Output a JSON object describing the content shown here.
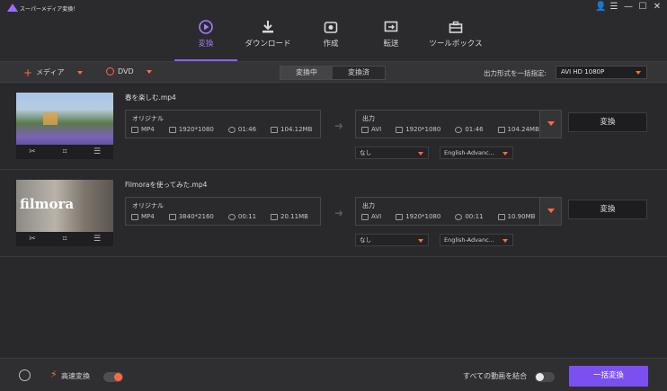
{
  "app": {
    "title": "スーパーメディア変換！"
  },
  "window_controls": [
    {
      "name": "user-icon",
      "glyph": "👤"
    },
    {
      "name": "menu-icon",
      "glyph": "☰"
    },
    {
      "name": "minimize-icon",
      "glyph": "—"
    },
    {
      "name": "maximize-icon",
      "glyph": "☐"
    },
    {
      "name": "close-icon",
      "glyph": "✕"
    }
  ],
  "nav": {
    "items": [
      {
        "label": "変換",
        "icon": "play-circle-icon",
        "active": true
      },
      {
        "label": "ダウンロード",
        "icon": "download-icon",
        "active": false
      },
      {
        "label": "作成",
        "icon": "disc-icon",
        "active": false
      },
      {
        "label": "転送",
        "icon": "transfer-icon",
        "active": false
      },
      {
        "label": "ツールボックス",
        "icon": "toolbox-icon",
        "active": false
      }
    ]
  },
  "toolbar": {
    "add_media": "メディア",
    "dvd": "DVD",
    "tabs": [
      "変換中",
      "変換済"
    ],
    "active_tab": "変換中",
    "format_label": "出力形式を一括指定:",
    "format_value": "AVI HD 1080P"
  },
  "files": [
    {
      "name": "春を楽しむ.mp4",
      "source": {
        "title": "オリジナル",
        "format": "MP4",
        "resolution": "1920*1080",
        "duration": "01:46",
        "size": "104.12MB"
      },
      "output": {
        "title": "出力",
        "format": "AVI",
        "resolution": "1920*1080",
        "duration": "01:46",
        "size": "104.24MB"
      },
      "subtitle": "なし",
      "audio": "English-Advanc...",
      "convert_label": "変換"
    },
    {
      "name": "Filmoraを使ってみた.mp4",
      "thumb_text": "filmora",
      "source": {
        "title": "オリジナル",
        "format": "MP4",
        "resolution": "3840*2160",
        "duration": "00:11",
        "size": "20.11MB"
      },
      "output": {
        "title": "出力",
        "format": "AVI",
        "resolution": "1920*1080",
        "duration": "00:11",
        "size": "10.90MB"
      },
      "subtitle": "なし",
      "audio": "English-Advanc...",
      "convert_label": "変換"
    }
  ],
  "bottom": {
    "fast_convert_label": "高速変換",
    "fast_convert_on": true,
    "merge_label": "すべての動画を結合",
    "merge_on": false,
    "convert_all_label": "一括変換"
  },
  "colors": {
    "accent": "#8e5cf7",
    "orange": "#ff6a3d",
    "bg": "#2b2a2c"
  }
}
